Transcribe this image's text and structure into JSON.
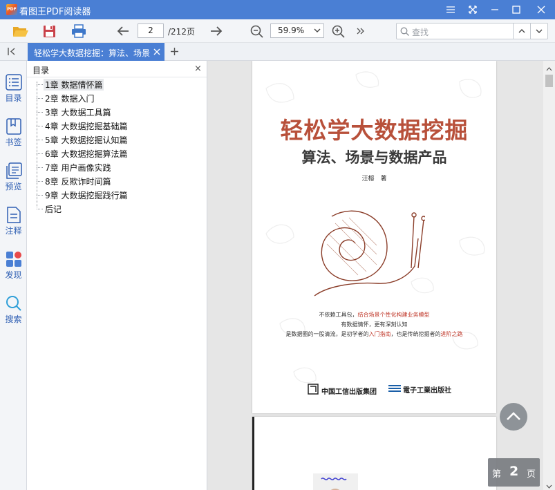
{
  "app": {
    "title": "看图王PDF阅读器",
    "logo_text": "PDF"
  },
  "toolbar": {
    "page_current": "2",
    "page_total": "/212页",
    "zoom": "59.9%",
    "search_placeholder": "查找"
  },
  "tabs": [
    {
      "label": "轻松学大数据挖掘：算法、场景与数据产品"
    }
  ],
  "leftnav": [
    {
      "label": "目录",
      "icon": "list-icon"
    },
    {
      "label": "书签",
      "icon": "bookmark-icon"
    },
    {
      "label": "预览",
      "icon": "preview-icon"
    },
    {
      "label": "注释",
      "icon": "note-icon"
    },
    {
      "label": "发现",
      "icon": "apps-icon"
    },
    {
      "label": "搜索",
      "icon": "search-icon"
    }
  ],
  "toc": {
    "title": "目录",
    "close": "×",
    "items": [
      "1章 数据情怀篇",
      "2章 数据入门",
      "3章 大数据工具篇",
      "4章 大数据挖掘基础篇",
      "5章 大数据挖掘认知篇",
      "6章 大数据挖掘算法篇",
      "7章 用户画像实践",
      "8章 反欺诈时间篇",
      "9章 大数据挖掘践行篇",
      "后记"
    ],
    "selected_index": 0
  },
  "cover": {
    "title": "轻松学大数据挖掘",
    "subtitle": "算法、场景与数据产品",
    "author": "汪榕　著",
    "blurb_line1_a": "不依赖工具包，",
    "blurb_line1_b": "结合场景个性化构建业务模型",
    "blurb_line2": "有数据情怀，更有深刻认知",
    "blurb_line3_a": "是数据圈的一股清流，是初学者的",
    "blurb_line3_b": "入门指南",
    "blurb_line3_c": "，也是传统挖掘者的",
    "blurb_line3_d": "进阶之路",
    "publisher_1": "中国工信出版集团",
    "publisher_2": "電子工業出版社"
  },
  "page_badge": {
    "prefix": "第",
    "number": "2",
    "suffix": "页"
  },
  "colors": {
    "accent": "#4a7fd4",
    "title_red": "#b8503a",
    "highlight_red": "#c0392b"
  }
}
